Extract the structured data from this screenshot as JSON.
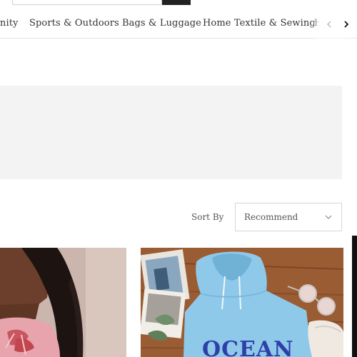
{
  "categories": [
    "nity",
    "Sports & Outdoors",
    "Bags & Luggage",
    "Home Textile & Sewing",
    "H"
  ],
  "sort": {
    "label": "Sort By",
    "value": "Recommend"
  },
  "products": [
    {
      "image": "model-wearing-pink-graphic-top"
    },
    {
      "image": "light-blue-hoodie-flatlay",
      "print_text": "OCEAN"
    }
  ],
  "colors": {
    "accent": "#222222",
    "banner": "#f3f3f3",
    "hoodie": "#8ec9ea",
    "hoodie_print": "#2f3fa8"
  }
}
